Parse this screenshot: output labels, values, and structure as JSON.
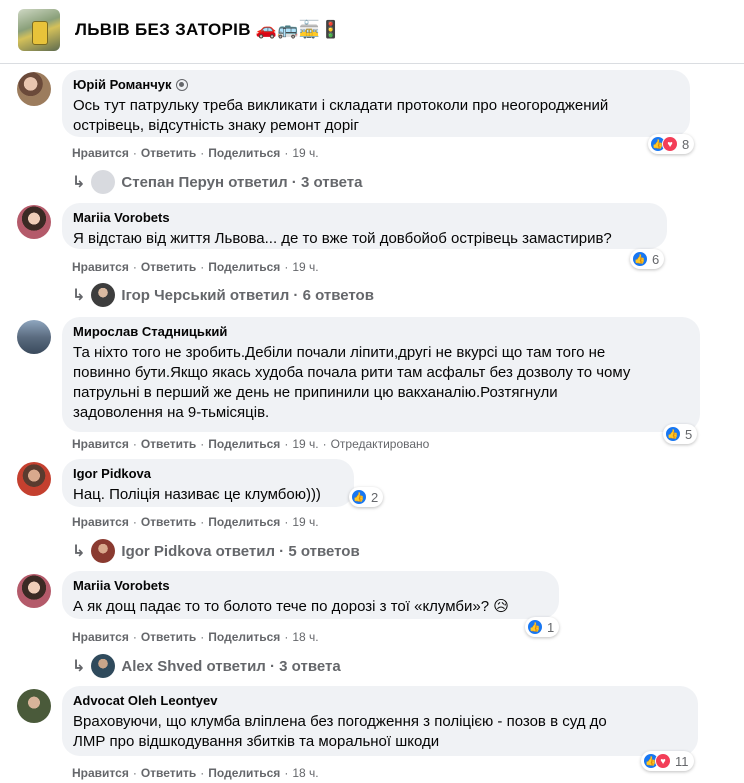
{
  "header": {
    "title": "ЛЬВІВ БЕЗ ЗАТОРІВ 🚗🚌🚋🚦"
  },
  "comments": [
    {
      "author": "Юрій Романчук",
      "text_lines": [
        "Ось тут патрульку треба викликати і складати протоколи про неогороджений",
        "острівець, відсутність знаку ремонт доріг"
      ],
      "reaction_count": "8",
      "actions": {
        "like": "Нравится",
        "reply": "Ответить",
        "share": "Поделиться",
        "time": "19 ч."
      },
      "replies": "Степан Перун ответил · 3 ответа"
    },
    {
      "author": "Mariia Vorobets",
      "text_lines": [
        "Я відстаю від життя Львова... де то вже той довбойоб острівець замастирив?"
      ],
      "reaction_count": "6",
      "actions": {
        "like": "Нравится",
        "reply": "Ответить",
        "share": "Поделиться",
        "time": "19 ч."
      },
      "replies": "Ігор Черський ответил · 6 ответов"
    },
    {
      "author": "Мирослав Стадницький",
      "text_lines": [
        "Та ніхто того не зробить.Дебіли почали ліпити,другі не вкурсі що там того не",
        "повинно бути.Якщо якась худоба почала рити там асфальт без дозволу то чому",
        "патрульні в перший же день не припинили цю вакханалію.Розтягнули",
        "задоволення на 9-тьмісяців."
      ],
      "reaction_count": "5",
      "actions": {
        "like": "Нравится",
        "reply": "Ответить",
        "share": "Поделиться",
        "time": "19 ч.",
        "edited": "Отредактировано"
      }
    },
    {
      "author": "Igor Pidkova",
      "text_lines": [
        "Нац. Поліція називає це клумбою)))"
      ],
      "reaction_count": "2",
      "actions": {
        "like": "Нравится",
        "reply": "Ответить",
        "share": "Поделиться",
        "time": "19 ч."
      },
      "replies": "Igor Pidkova ответил · 5 ответов"
    },
    {
      "author": "Mariia Vorobets",
      "text_lines": [
        "А як дощ падає то то болото тече по дорозі з тої «клумби»? 😥"
      ],
      "reaction_count": "1",
      "actions": {
        "like": "Нравится",
        "reply": "Ответить",
        "share": "Поделиться",
        "time": "18 ч."
      },
      "replies": "Alex Shved ответил · 3 ответа"
    },
    {
      "author": "Advocat Oleh Leontyev",
      "text_lines": [
        "Враховуючи, що клумба вліплена без погодження з поліцією - позов в суд до",
        "ЛМР про відшкодування збитків та моральної шкоди"
      ],
      "reaction_count": "11",
      "actions": {
        "like": "Нравится",
        "reply": "Ответить",
        "share": "Поделиться",
        "time": "18 ч."
      }
    }
  ],
  "colors": {
    "like": "#1877f2",
    "love": "#f33e58",
    "care": "#f7b125",
    "bubble": "#f0f2f5",
    "meta": "#65676b"
  }
}
